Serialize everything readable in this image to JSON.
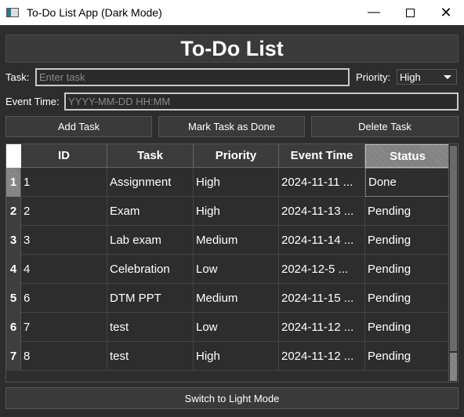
{
  "window": {
    "title": "To-Do List App (Dark Mode)"
  },
  "header": {
    "title": "To-Do List"
  },
  "form": {
    "task_label": "Task:",
    "task_placeholder": "Enter task",
    "priority_label": "Priority:",
    "priority_value": "High",
    "event_label": "Event Time:",
    "event_placeholder": "YYYY-MM-DD HH:MM"
  },
  "buttons": {
    "add": "Add Task",
    "done": "Mark Task as Done",
    "delete": "Delete Task",
    "theme": "Switch to Light Mode"
  },
  "table": {
    "columns": [
      "ID",
      "Task",
      "Priority",
      "Event Time",
      "Status"
    ],
    "rows": [
      {
        "num": "1",
        "id": "1",
        "task": "Assignment",
        "priority": "High",
        "time": "2024-11-11 ...",
        "status": "Done"
      },
      {
        "num": "2",
        "id": "2",
        "task": "Exam",
        "priority": "High",
        "time": "2024-11-13 ...",
        "status": "Pending"
      },
      {
        "num": "3",
        "id": "3",
        "task": "Lab exam",
        "priority": "Medium",
        "time": "2024-11-14 ...",
        "status": "Pending"
      },
      {
        "num": "4",
        "id": "4",
        "task": "Celebration",
        "priority": "Low",
        "time": "2024-12-5 ...",
        "status": "Pending"
      },
      {
        "num": "5",
        "id": "6",
        "task": "DTM PPT",
        "priority": "Medium",
        "time": "2024-11-15 ...",
        "status": "Pending"
      },
      {
        "num": "6",
        "id": "7",
        "task": "test",
        "priority": "Low",
        "time": "2024-11-12 ...",
        "status": "Pending"
      },
      {
        "num": "7",
        "id": "8",
        "task": "test",
        "priority": "High",
        "time": "2024-11-12 ...",
        "status": "Pending"
      }
    ]
  }
}
